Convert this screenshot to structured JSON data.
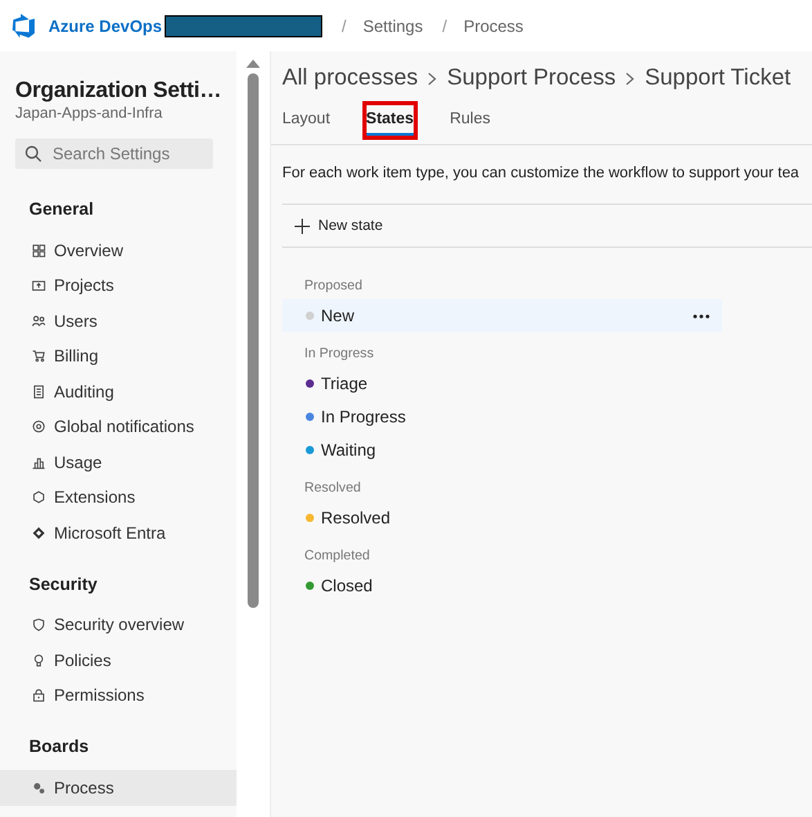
{
  "header": {
    "product": "Azure DevOps",
    "breadcrumb": [
      {
        "separator": "/",
        "label": "Settings"
      },
      {
        "separator": "/",
        "label": "Process"
      }
    ]
  },
  "sidebar": {
    "title": "Organization Setti…",
    "subtitle": "Japan-Apps-and-Infra",
    "search": {
      "placeholder": "Search Settings"
    },
    "sections": [
      {
        "heading": "General",
        "items": [
          {
            "label": "Overview",
            "selected": false
          },
          {
            "label": "Projects",
            "selected": false
          },
          {
            "label": "Users",
            "selected": false
          },
          {
            "label": "Billing",
            "selected": false
          },
          {
            "label": "Auditing",
            "selected": false
          },
          {
            "label": "Global notifications",
            "selected": false
          },
          {
            "label": "Usage",
            "selected": false
          },
          {
            "label": "Extensions",
            "selected": false
          },
          {
            "label": "Microsoft Entra",
            "selected": false
          }
        ]
      },
      {
        "heading": "Security",
        "items": [
          {
            "label": "Security overview",
            "selected": false
          },
          {
            "label": "Policies",
            "selected": false
          },
          {
            "label": "Permissions",
            "selected": false
          }
        ]
      },
      {
        "heading": "Boards",
        "items": [
          {
            "label": "Process",
            "selected": true
          }
        ]
      }
    ]
  },
  "main": {
    "breadcrumb": [
      "All processes",
      "Support Process",
      "Support Ticket"
    ],
    "tabs": [
      {
        "label": "Layout",
        "selected": false,
        "highlighted": false
      },
      {
        "label": "States",
        "selected": true,
        "highlighted": true
      },
      {
        "label": "Rules",
        "selected": false,
        "highlighted": false
      }
    ],
    "description": "For each work item type, you can customize the workflow to support your tea",
    "new_button": "New state",
    "categories": [
      {
        "label": "Proposed",
        "states": [
          {
            "name": "New",
            "color": "#d0d0d0",
            "selected": true
          }
        ]
      },
      {
        "label": "In Progress",
        "states": [
          {
            "name": "Triage",
            "color": "#5c2d91",
            "selected": false
          },
          {
            "name": "In Progress",
            "color": "#4a86e0",
            "selected": false
          },
          {
            "name": "Waiting",
            "color": "#1a9ad6",
            "selected": false
          }
        ]
      },
      {
        "label": "Resolved",
        "states": [
          {
            "name": "Resolved",
            "color": "#f7b731",
            "selected": false
          }
        ]
      },
      {
        "label": "Completed",
        "states": [
          {
            "name": "Closed",
            "color": "#339933",
            "selected": false
          }
        ]
      }
    ]
  }
}
